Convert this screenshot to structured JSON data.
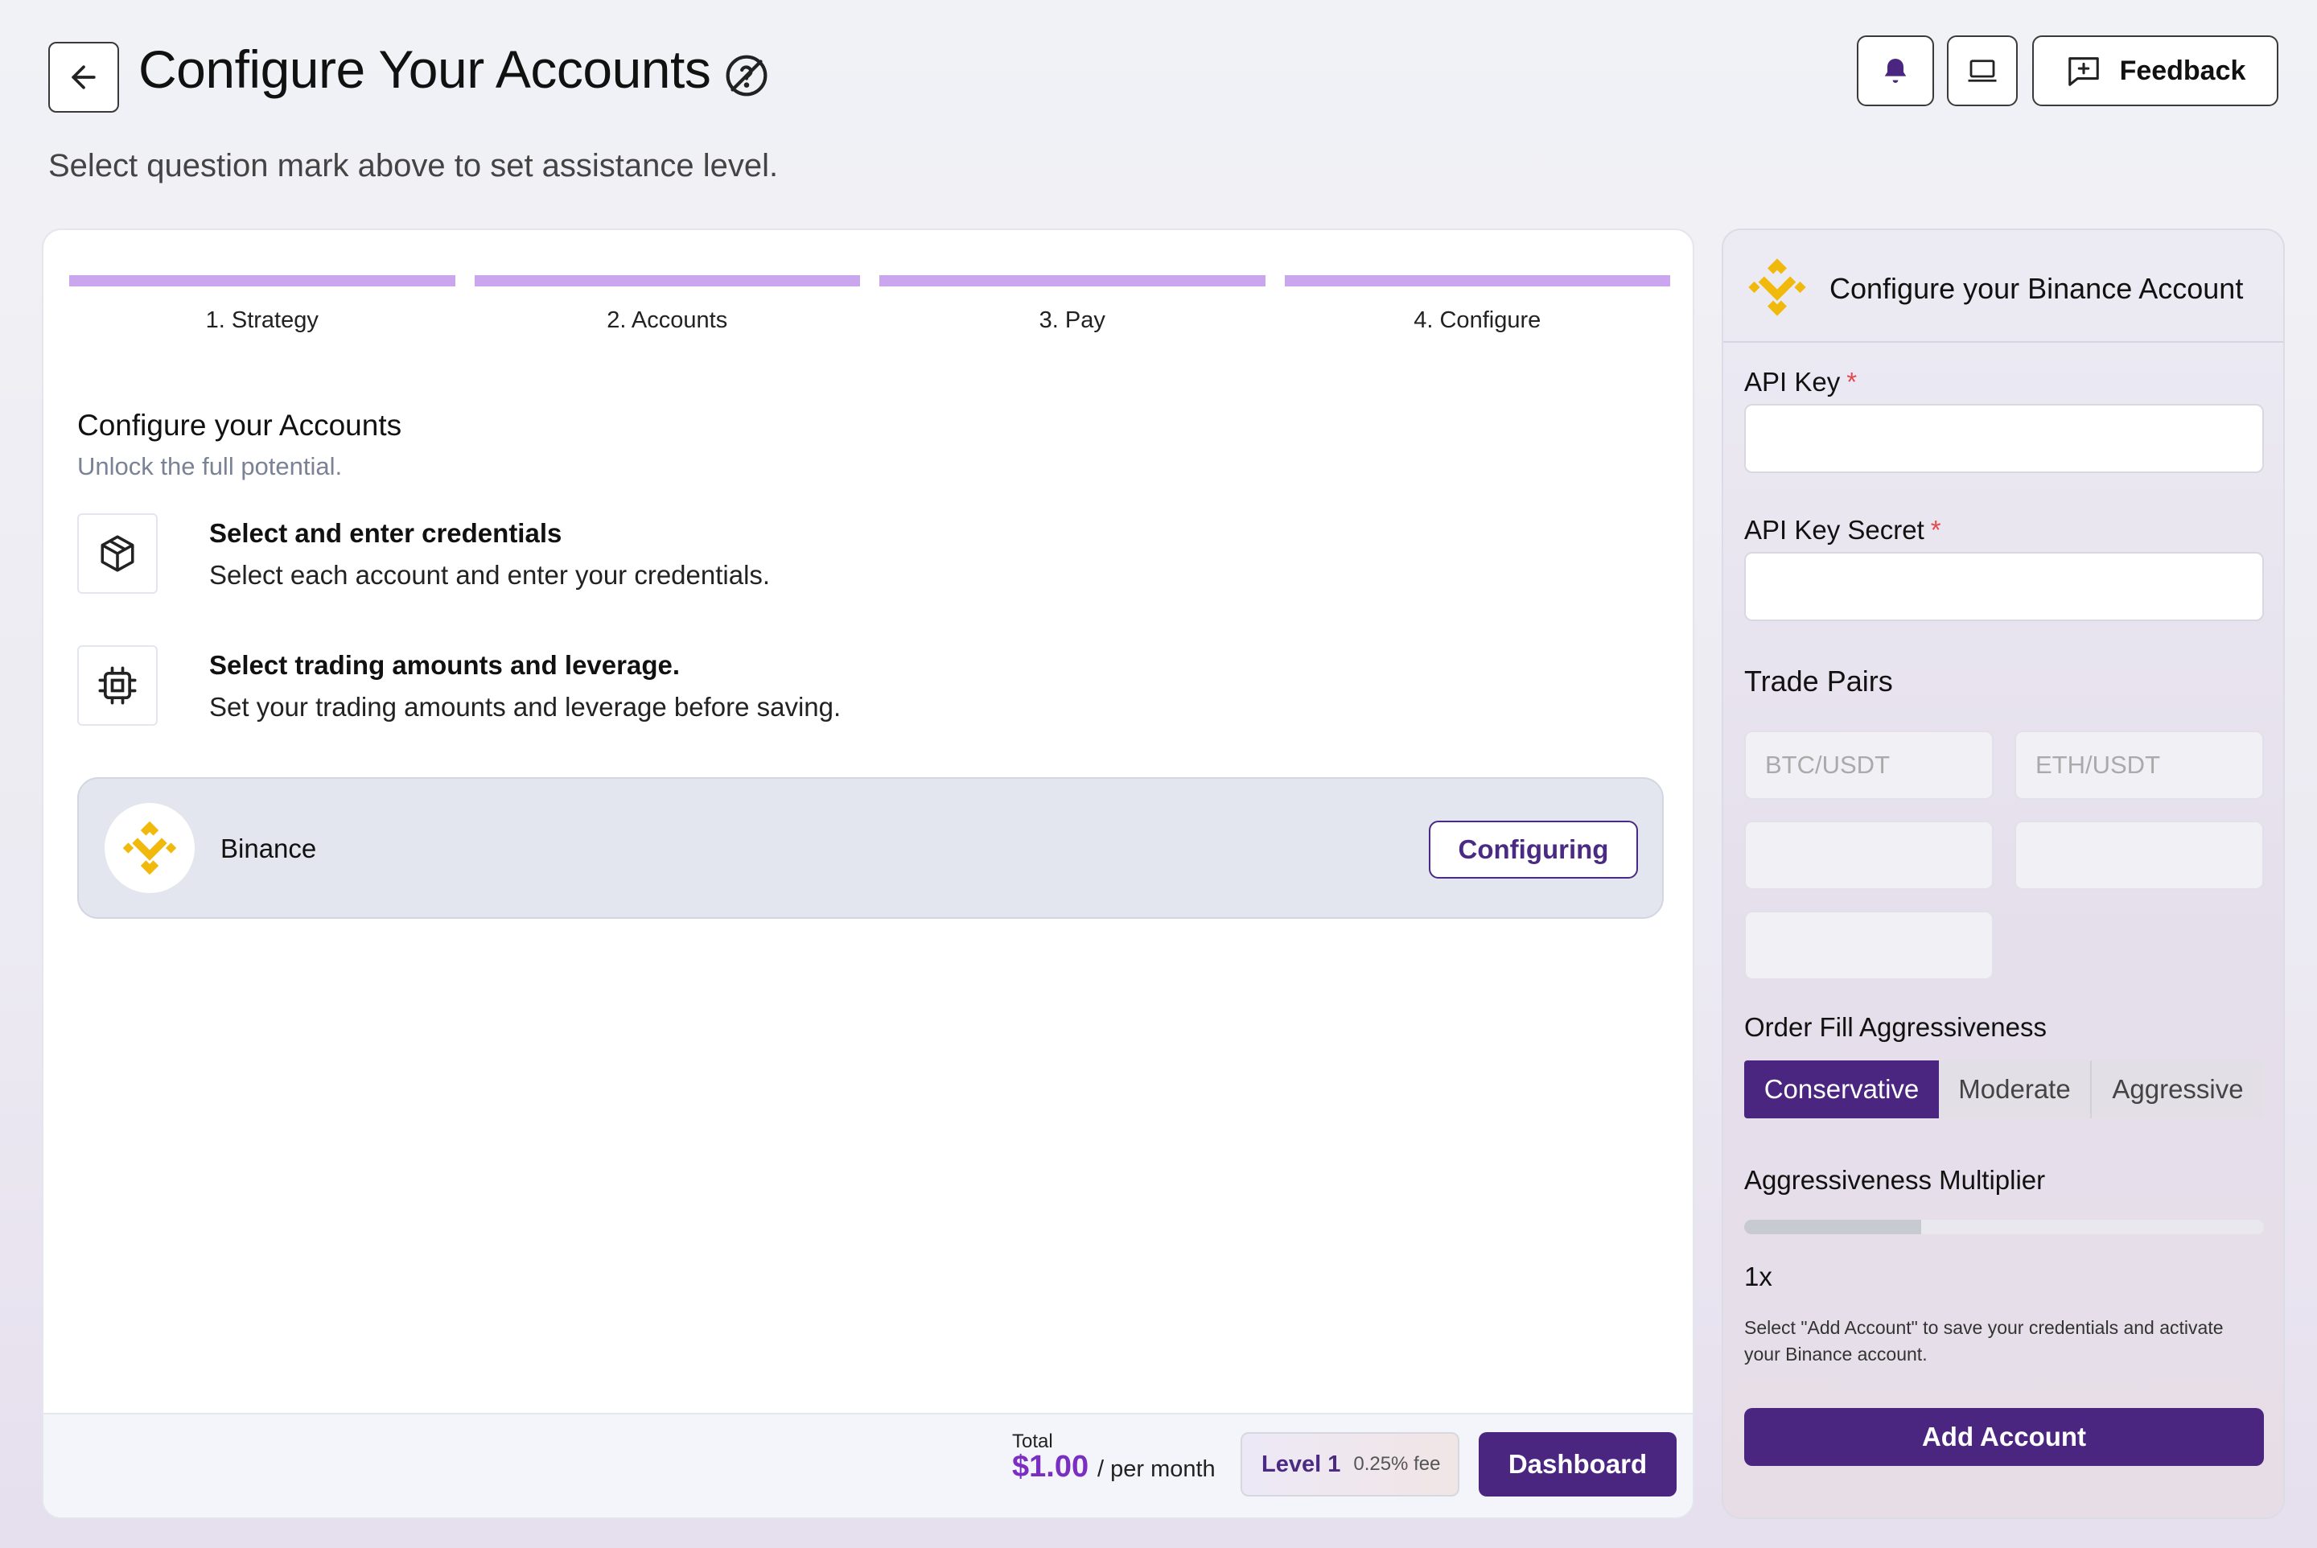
{
  "header": {
    "title": "Configure Your Accounts",
    "subtitle": "Select question mark above to set assistance level.",
    "feedback_label": "Feedback"
  },
  "steps": [
    {
      "label": "1. Strategy"
    },
    {
      "label": "2. Accounts"
    },
    {
      "label": "3. Pay"
    },
    {
      "label": "4. Configure"
    }
  ],
  "main": {
    "section_title": "Configure your Accounts",
    "section_subtitle": "Unlock the full potential.",
    "features": [
      {
        "title": "Select and enter credentials",
        "desc": "Select each account and enter your credentials.",
        "icon": "cube-icon"
      },
      {
        "title": "Select trading amounts and leverage.",
        "desc": "Set your trading amounts and leverage before saving.",
        "icon": "chip-icon"
      }
    ],
    "account": {
      "name": "Binance",
      "status_button": "Configuring"
    }
  },
  "footer": {
    "total_label": "Total",
    "total_value": "$1.00",
    "total_period": "/ per month",
    "level_name": "Level 1",
    "level_fee": "0.25% fee",
    "dashboard_label": "Dashboard"
  },
  "side": {
    "title": "Configure your Binance Account",
    "api_key_label": "API Key",
    "api_secret_label": "API Key Secret",
    "required_mark": "*",
    "api_key_value": "",
    "api_secret_value": "",
    "trade_pairs_title": "Trade Pairs",
    "trade_pairs": [
      "BTC/USDT",
      "ETH/USDT",
      "",
      "",
      ""
    ],
    "aggressiveness_title": "Order Fill Aggressiveness",
    "aggressiveness_options": [
      "Conservative",
      "Moderate",
      "Aggressive"
    ],
    "aggressiveness_selected": "Conservative",
    "multiplier_title": "Aggressiveness Multiplier",
    "multiplier_fraction": 0.34,
    "multiplier_value": "1x",
    "note": "Select \"Add Account\" to save your credentials and activate your Binance account.",
    "add_account_label": "Add Account"
  },
  "colors": {
    "accent": "#4b2680",
    "step_bar": "#c9a6ee",
    "price": "#7a2fc2",
    "binance": "#f0b90b",
    "required": "#e5484d"
  }
}
